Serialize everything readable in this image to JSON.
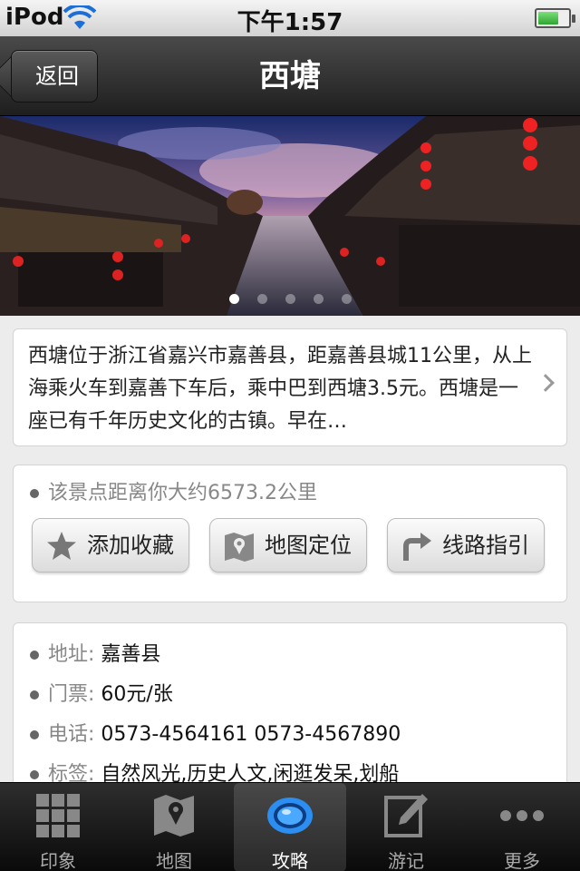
{
  "status_bar": {
    "carrier": "iPod",
    "time": "下午1:57"
  },
  "nav": {
    "back_label": "返回",
    "title": "西塘"
  },
  "carousel": {
    "page_count": 5,
    "active_index": 0
  },
  "description": {
    "text": "西塘位于浙江省嘉兴市嘉善县，距嘉善县城11公里，从上海乘火车到嘉善下车后，乘中巴到西塘3.5元。西塘是一座已有千年历史文化的古镇。早在…"
  },
  "distance": {
    "text": "该景点距离你大约6573.2公里"
  },
  "actions": [
    {
      "label": "添加收藏",
      "icon": "star-icon"
    },
    {
      "label": "地图定位",
      "icon": "map-pin-icon"
    },
    {
      "label": "线路指引",
      "icon": "route-arrow-icon"
    }
  ],
  "info": [
    {
      "label": "地址:",
      "value": "嘉善县"
    },
    {
      "label": "门票:",
      "value": "60元/张"
    },
    {
      "label": "电话:",
      "value": "0573-4564161 0573-4567890"
    },
    {
      "label": "标签:",
      "value": "自然风光,历史人文,闲逛发呆,划船"
    }
  ],
  "tabs": [
    {
      "label": "印象",
      "icon": "grid-icon"
    },
    {
      "label": "地图",
      "icon": "map-icon"
    },
    {
      "label": "攻略",
      "icon": "eye-ring-icon",
      "active": true
    },
    {
      "label": "游记",
      "icon": "edit-icon"
    },
    {
      "label": "更多",
      "icon": "more-dots-icon"
    }
  ],
  "colors": {
    "nav_bg": "#2a2a2a",
    "accent_blue": "#1e88e5"
  }
}
